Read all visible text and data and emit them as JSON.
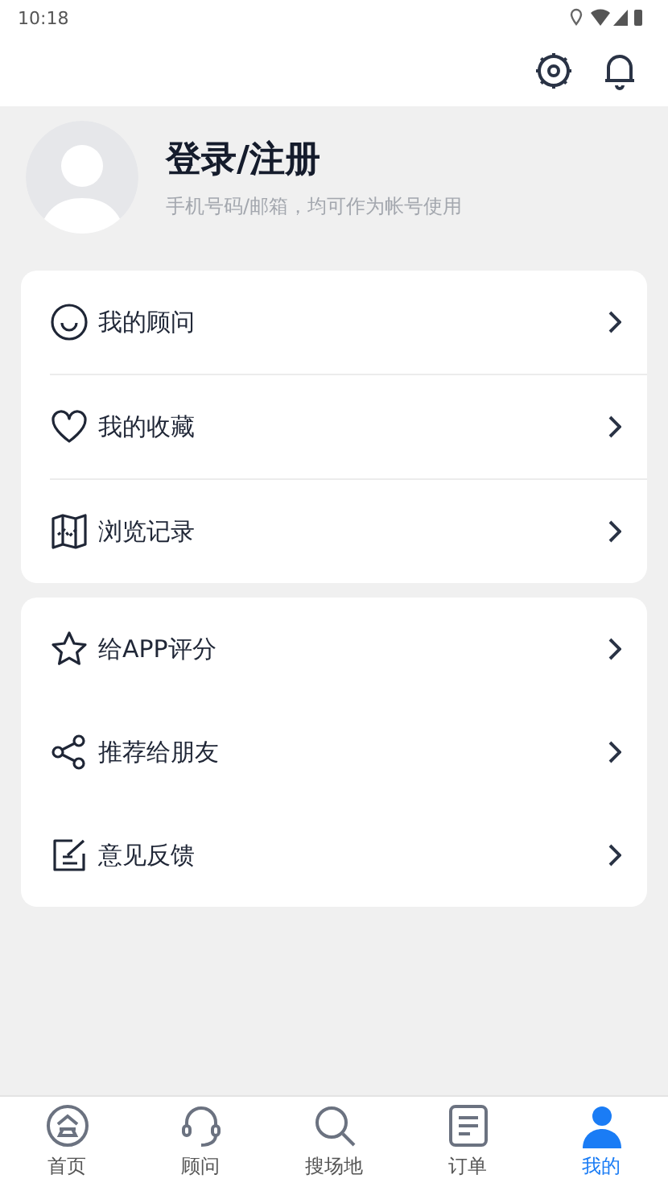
{
  "status_bar": {
    "time": "10:18"
  },
  "profile": {
    "title": "登录/注册",
    "subtitle": "手机号码/邮箱，均可作为帐号使用"
  },
  "menu_groups": [
    {
      "dividers": true,
      "items": [
        {
          "kind": "smile",
          "label": "我的顾问"
        },
        {
          "kind": "heart",
          "label": "我的收藏"
        },
        {
          "kind": "map",
          "label": "浏览记录"
        }
      ]
    },
    {
      "dividers": false,
      "items": [
        {
          "kind": "star",
          "label": "给APP评分"
        },
        {
          "kind": "share",
          "label": "推荐给朋友"
        },
        {
          "kind": "edit",
          "label": "意见反馈"
        }
      ]
    }
  ],
  "tabs": [
    {
      "kind": "home",
      "label": "首页",
      "selected": false
    },
    {
      "kind": "headset",
      "label": "顾问",
      "selected": false
    },
    {
      "kind": "search",
      "label": "搜场地",
      "selected": false
    },
    {
      "kind": "list",
      "label": "订单",
      "selected": false
    },
    {
      "kind": "person",
      "label": "我的",
      "selected": true
    }
  ]
}
